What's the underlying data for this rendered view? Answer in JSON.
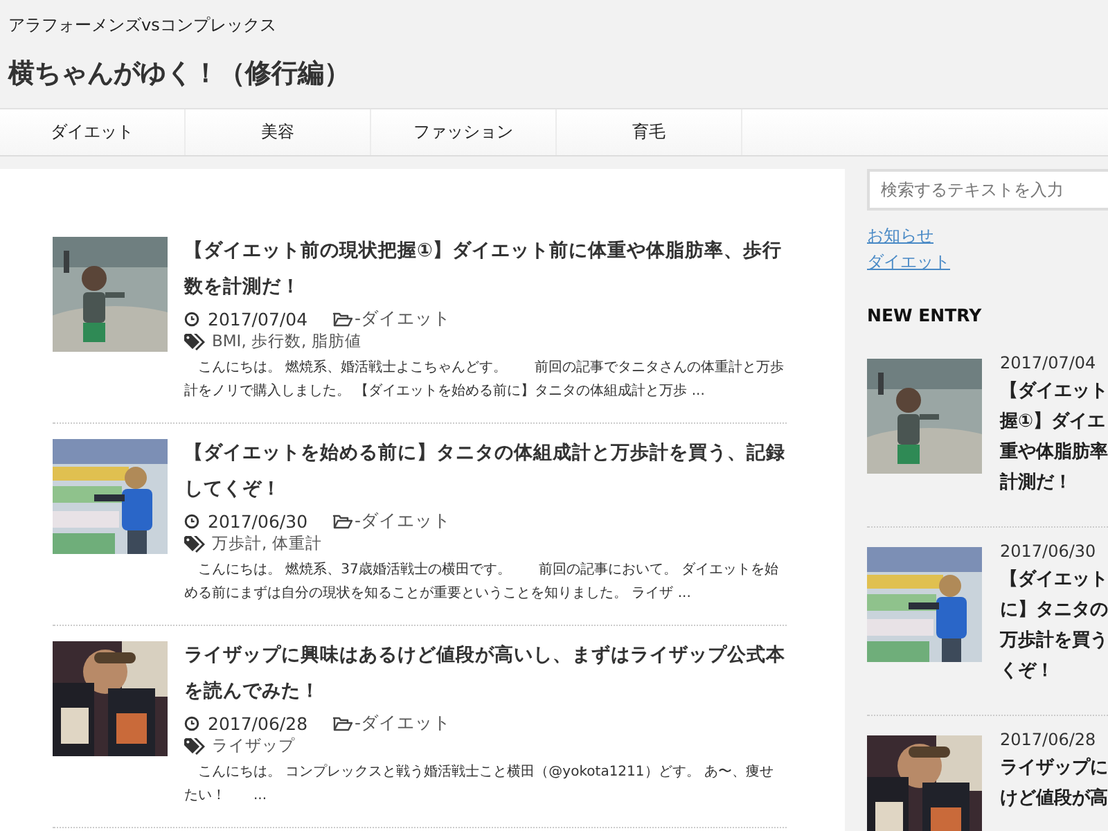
{
  "header": {
    "tagline": "アラフォーメンズvsコンプレックス",
    "site_title": "横ちゃんがゆく！（修行編）"
  },
  "nav": [
    {
      "label": "ダイエット"
    },
    {
      "label": "美容"
    },
    {
      "label": "ファッション"
    },
    {
      "label": "育毛"
    }
  ],
  "posts": [
    {
      "title": "【ダイエット前の現状把握①】ダイエット前に体重や体脂肪率、歩行数を計測だ！",
      "date": "2017/07/04",
      "category": "-ダイエット",
      "tags": "BMI, 歩行数, 脂肪値",
      "excerpt": "こんにちは。 燃焼系、婚活戦士よこちゃんどす。　　前回の記事でタニタさんの体重計と万歩計をノリで購入しました。 【ダイエットを始める前に】タニタの体組成計と万歩 ..."
    },
    {
      "title": "【ダイエットを始める前に】タニタの体組成計と万歩計を買う、記録してくぞ！",
      "date": "2017/06/30",
      "category": "-ダイエット",
      "tags": "万歩計, 体重計",
      "excerpt": "こんにちは。 燃焼系、37歳婚活戦士の横田です。　　前回の記事において。 ダイエットを始める前にまずは自分の現状を知ることが重要ということを知りました。 ライザ ..."
    },
    {
      "title": "ライザップに興味はあるけど値段が高いし、まずはライザップ公式本を読んでみた！",
      "date": "2017/06/28",
      "category": "-ダイエット",
      "tags": "ライザップ",
      "excerpt": "こんにちは。 コンプレックスと戦う婚活戦士こと横田（@yokota1211）どす。 あ〜、痩せたい！　　..."
    }
  ],
  "sidebar": {
    "search": {
      "placeholder": "検索するテキストを入力"
    },
    "links": [
      "お知らせ",
      "ダイエット"
    ],
    "heading": "NEW ENTRY",
    "entries": [
      {
        "date": "2017/07/04",
        "title_lines": [
          "【ダイエット",
          "握①】ダイエ",
          "重や体脂肪率",
          "計測だ！"
        ]
      },
      {
        "date": "2017/06/30",
        "title_lines": [
          "【ダイエット",
          "に】タニタの",
          "万歩計を買う",
          "くぞ！"
        ]
      },
      {
        "date": "2017/06/28",
        "title_lines": [
          "ライザップに",
          "けど値段が高"
        ]
      }
    ]
  }
}
